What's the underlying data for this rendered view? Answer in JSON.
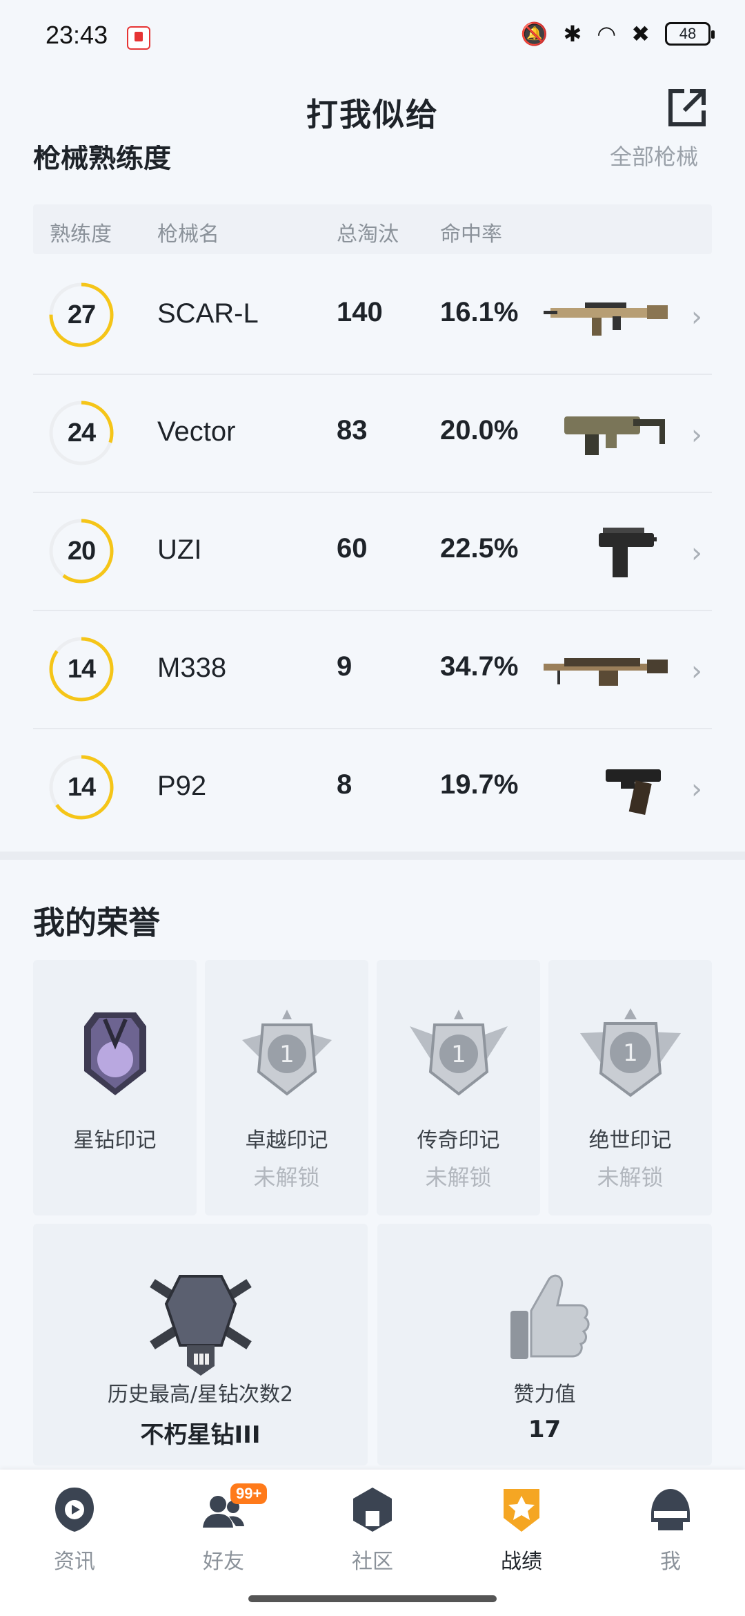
{
  "status": {
    "time": "23:43",
    "battery": "48"
  },
  "header": {
    "title": "打我似给"
  },
  "weapons": {
    "section_title": "枪械熟练度",
    "more_label": "全部枪械",
    "columns": {
      "proficiency": "熟练度",
      "name": "枪械名",
      "kills": "总淘汰",
      "accuracy": "命中率"
    },
    "rows": [
      {
        "level": "27",
        "name": "SCAR-L",
        "kills": "140",
        "accuracy": "16.1%",
        "progress": 0.75,
        "icon": "rifle-icon"
      },
      {
        "level": "24",
        "name": "Vector",
        "kills": "83",
        "accuracy": "20.0%",
        "progress": 0.3,
        "icon": "smg-icon"
      },
      {
        "level": "20",
        "name": "UZI",
        "kills": "60",
        "accuracy": "22.5%",
        "progress": 0.6,
        "icon": "uzi-icon"
      },
      {
        "level": "14",
        "name": "M338",
        "kills": "9",
        "accuracy": "34.7%",
        "progress": 0.85,
        "icon": "lmg-icon"
      },
      {
        "level": "14",
        "name": "P92",
        "kills": "8",
        "accuracy": "19.7%",
        "progress": 0.65,
        "icon": "pistol-icon"
      }
    ]
  },
  "honors": {
    "title": "我的荣誉",
    "badges": [
      {
        "label": "星钻印记",
        "status": ""
      },
      {
        "label": "卓越印记",
        "status": "未解锁"
      },
      {
        "label": "传奇印记",
        "status": "未解锁"
      },
      {
        "label": "绝世印记",
        "status": "未解锁"
      }
    ],
    "rank": {
      "label": "历史最高/星钻次数2",
      "value": "不朽星钻III"
    },
    "likes": {
      "label": "赞力值",
      "value": "17"
    }
  },
  "nav": {
    "items": [
      {
        "label": "资讯"
      },
      {
        "label": "好友",
        "badge": "99+"
      },
      {
        "label": "社区"
      },
      {
        "label": "战绩"
      },
      {
        "label": "我"
      }
    ]
  },
  "colors": {
    "accent": "#f5c518",
    "ring_track": "#eceef1"
  }
}
